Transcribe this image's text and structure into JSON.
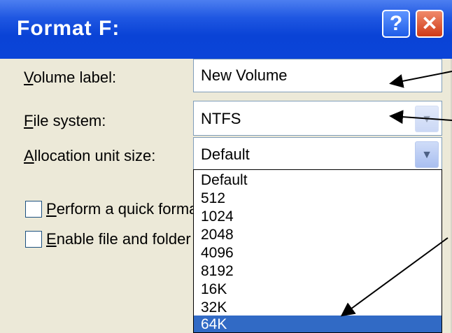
{
  "window": {
    "title": "Format F:",
    "help_glyph": "?",
    "close_glyph": "✕"
  },
  "volume_label": {
    "label_mnemonic": "V",
    "label_rest": "olume label:",
    "value": "New Volume"
  },
  "file_system": {
    "label_mnemonic": "F",
    "label_rest": "ile system:",
    "value": "NTFS",
    "arrow_glyph": "▼"
  },
  "allocation": {
    "label_mnemonic": "A",
    "label_rest": "llocation unit size:",
    "value": "Default",
    "arrow_glyph": "▼",
    "options": [
      "Default",
      "512",
      "1024",
      "2048",
      "4096",
      "8192",
      "16K",
      "32K",
      "64K"
    ],
    "highlighted": "64K"
  },
  "options": {
    "quick_format": {
      "mnemonic": "P",
      "rest": "erform a quick format"
    },
    "compression": {
      "mnemonic": "E",
      "rest": "nable file and folder compression"
    }
  },
  "colors": {
    "title_bar": "#0a43d6",
    "highlight": "#316ac5"
  }
}
